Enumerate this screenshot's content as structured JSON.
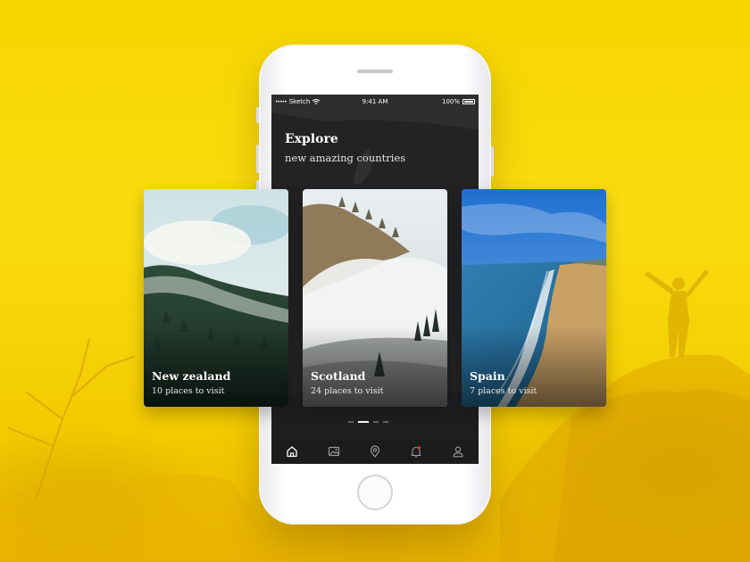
{
  "status_bar": {
    "signal": "•••••",
    "carrier": "Sketch",
    "time": "9:41 AM",
    "battery": "100%"
  },
  "header": {
    "title": "Explore",
    "subtitle": "new amazing countries"
  },
  "cards": [
    {
      "name": "New zealand",
      "count": "10 places to visit"
    },
    {
      "name": "Scotland",
      "count": "24 places to visit"
    },
    {
      "name": "Spain",
      "count": "7 places to visit"
    }
  ],
  "pager": {
    "pages": 4,
    "active_index": 1
  },
  "tabs": [
    {
      "icon": "home-icon",
      "active": true
    },
    {
      "icon": "gallery-icon",
      "active": false
    },
    {
      "icon": "location-pin-icon",
      "active": false
    },
    {
      "icon": "notification-bell-icon",
      "active": false,
      "badge": true
    },
    {
      "icon": "profile-icon",
      "active": false
    }
  ],
  "colors": {
    "accent": "#e8321f",
    "background": "#f6d600",
    "screen": "#222224"
  }
}
